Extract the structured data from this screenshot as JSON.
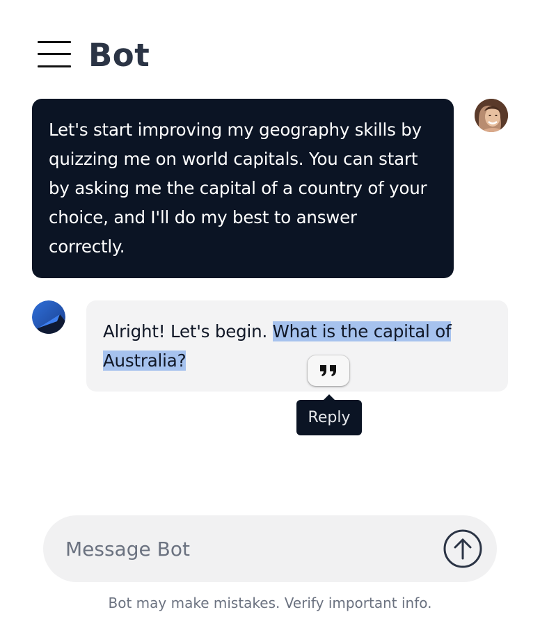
{
  "header": {
    "title": "Bot",
    "menu_icon": "hamburger-menu-icon"
  },
  "messages": [
    {
      "role": "user",
      "text": "Let's start improving my geography skills by quizzing me on world capitals. You can start by asking me the capital of a country of your choice, and I'll do my best to answer correctly.",
      "avatar": "user-avatar"
    },
    {
      "role": "bot",
      "text_before": "Alright! Let's begin. ",
      "text_selected": "What is the capital of Australia?",
      "avatar": "bot-avatar"
    }
  ],
  "selection_popup": {
    "icon": "quote-icon",
    "tooltip": "Reply"
  },
  "composer": {
    "placeholder": "Message Bot",
    "value": "",
    "send_icon": "arrow-up-circle-icon"
  },
  "footer": {
    "disclaimer": "Bot may make mistakes. Verify important info."
  },
  "colors": {
    "user_bubble": "#0b1424",
    "bot_bubble": "#f3f3f4",
    "selection": "#a6c2ee",
    "title": "#2b3445"
  }
}
